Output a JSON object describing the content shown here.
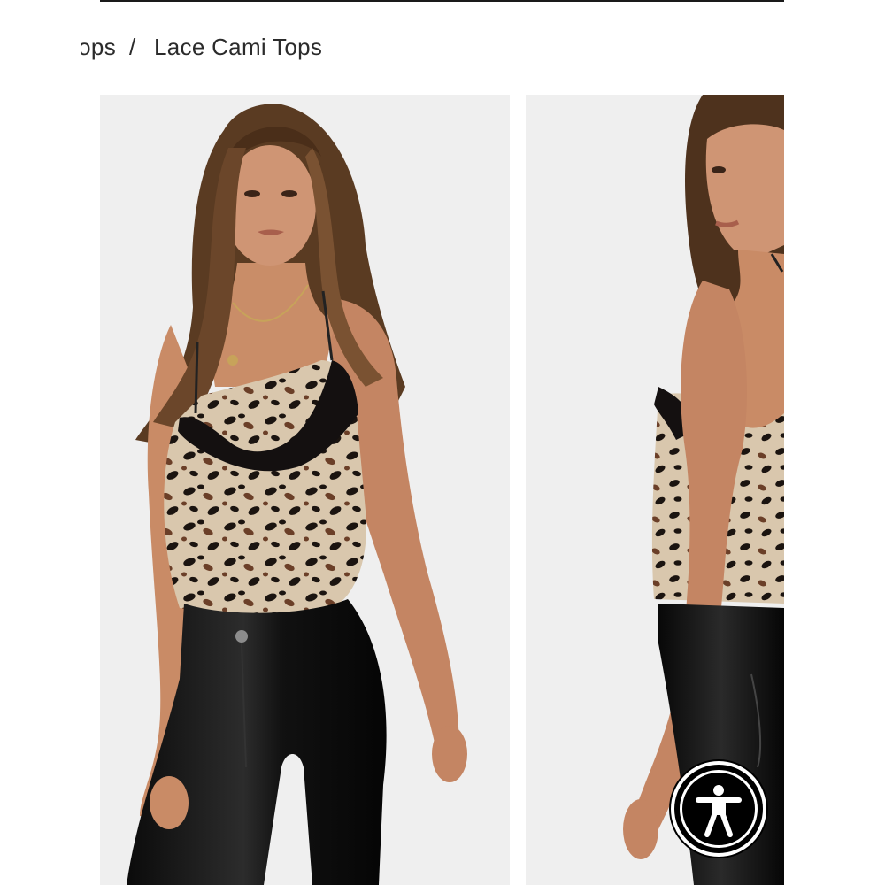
{
  "breadcrumb": {
    "previous": "Tops",
    "separator": "/",
    "current": "Lace Cami Tops"
  },
  "gallery": {
    "images": [
      {
        "alt": "model-front-view"
      },
      {
        "alt": "model-side-view"
      }
    ]
  },
  "accessibility": {
    "icon": "accessibility-person-icon"
  },
  "colors": {
    "background": "#ffffff",
    "photo_backdrop": "#efefef",
    "text": "#2b2b2b",
    "button": "#000000"
  }
}
